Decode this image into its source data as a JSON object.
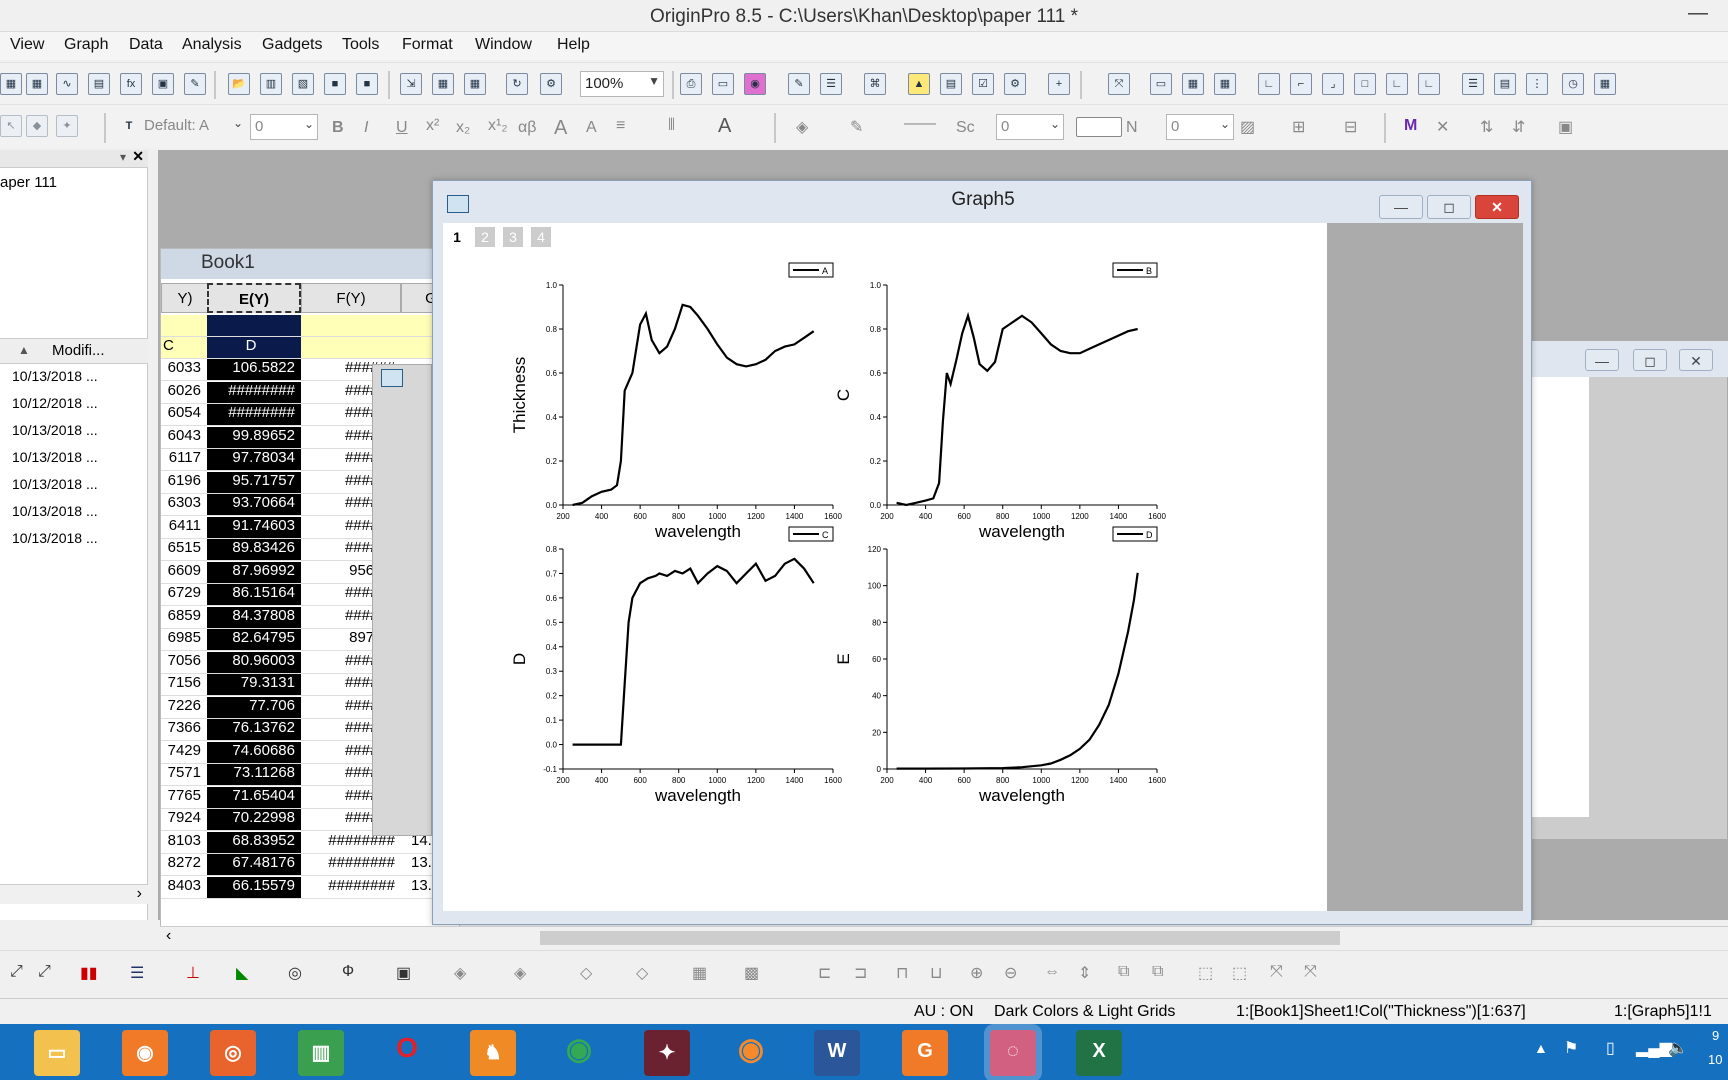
{
  "app": {
    "title": "OriginPro 8.5 - C:\\Users\\Khan\\Desktop\\paper 111 *"
  },
  "menu": [
    "View",
    "Graph",
    "Data",
    "Analysis",
    "Gadgets",
    "Tools",
    "Format",
    "Window",
    "Help"
  ],
  "toolbar": {
    "zoom": "100%",
    "font_name": "Default: A",
    "font_size": "0",
    "line_style": "Sc",
    "line_width": "0",
    "fill_label": "N",
    "fill_width": "0"
  },
  "project": {
    "folder": "aper 111",
    "column_header": "Modifi...",
    "dates": [
      "10/13/2018 ...",
      "10/12/2018 ...",
      "10/13/2018 ...",
      "10/13/2018 ...",
      "10/13/2018 ...",
      "10/13/2018 ...",
      "10/13/2018 ..."
    ]
  },
  "book1": {
    "title": "Book1",
    "col_left_header": "Y)",
    "col_e_header": "E(Y)",
    "col_f_header": "F(Y)",
    "col_g_header": "G",
    "row_c": "C",
    "row_d": "D",
    "left_col": [
      "6033",
      "6026",
      "6054",
      "6043",
      "6117",
      "6196",
      "6303",
      "6411",
      "6515",
      "6609",
      "6729",
      "6859",
      "6985",
      "7056",
      "7156",
      "7226",
      "7366",
      "7429",
      "7571",
      "7765",
      "7924",
      "8103",
      "8272",
      "8403"
    ],
    "e_col": [
      "106.5822",
      "########",
      "########",
      "99.89652",
      "97.78034",
      "95.71757",
      "93.70664",
      "91.74603",
      "89.83426",
      "87.96992",
      "86.15164",
      "84.37808",
      "82.64795",
      "80.96003",
      "79.3131",
      "77.706",
      "76.13762",
      "74.60686",
      "73.11268",
      "71.65404",
      "70.22998",
      "68.83952",
      "67.48176",
      "66.15579"
    ],
    "f_col": [
      "######",
      "######",
      "######",
      "######",
      "######",
      "######",
      "######",
      "######",
      "######",
      "956.22",
      "######",
      "######",
      "897.93",
      "######",
      "######",
      "######",
      "######",
      "######",
      "######",
      "######",
      "######",
      "########",
      "########",
      "########"
    ],
    "g_col": [
      "",
      "",
      "",
      "",
      "",
      "",
      "",
      "",
      "",
      "",
      "",
      "",
      "",
      "",
      "",
      "",
      "",
      "",
      "",
      "",
      "",
      "14.",
      "13.",
      "13."
    ]
  },
  "graph": {
    "title": "Graph5",
    "layers": [
      "1",
      "2",
      "3",
      "4"
    ],
    "xlabel": "wavelength"
  },
  "chart_data": [
    {
      "type": "line",
      "legend": "A",
      "ylabel": "Thickness",
      "xlabel": "wavelength",
      "xlim": [
        200,
        1600
      ],
      "ylim": [
        0.0,
        1.0
      ],
      "xticks": [
        "200",
        "400",
        "600",
        "800",
        "1000",
        "1200",
        "1400",
        "1600"
      ],
      "yticks": [
        "0.0",
        "0.2",
        "0.4",
        "0.6",
        "0.8",
        "1.0"
      ],
      "x": [
        250,
        300,
        350,
        400,
        450,
        480,
        500,
        520,
        560,
        600,
        630,
        660,
        700,
        740,
        780,
        820,
        860,
        900,
        950,
        1000,
        1050,
        1100,
        1150,
        1200,
        1250,
        1300,
        1350,
        1400,
        1450,
        1500
      ],
      "y": [
        0.0,
        0.01,
        0.04,
        0.06,
        0.07,
        0.09,
        0.2,
        0.52,
        0.6,
        0.82,
        0.87,
        0.75,
        0.69,
        0.72,
        0.8,
        0.91,
        0.9,
        0.86,
        0.8,
        0.73,
        0.67,
        0.64,
        0.63,
        0.64,
        0.66,
        0.7,
        0.72,
        0.73,
        0.76,
        0.79
      ]
    },
    {
      "type": "line",
      "legend": "B",
      "ylabel": "C",
      "xlabel": "wavelength",
      "xlim": [
        200,
        1600
      ],
      "ylim": [
        0.0,
        1.0
      ],
      "xticks": [
        "200",
        "400",
        "600",
        "800",
        "1000",
        "1200",
        "1400",
        "1600"
      ],
      "yticks": [
        "0.0",
        "0.2",
        "0.4",
        "0.6",
        "0.8",
        "1.0"
      ],
      "x": [
        250,
        300,
        350,
        400,
        440,
        470,
        490,
        510,
        530,
        560,
        590,
        620,
        650,
        680,
        720,
        760,
        800,
        850,
        900,
        950,
        1000,
        1050,
        1100,
        1150,
        1200,
        1250,
        1300,
        1350,
        1400,
        1450,
        1500
      ],
      "y": [
        0.01,
        0.0,
        0.01,
        0.02,
        0.03,
        0.1,
        0.38,
        0.6,
        0.55,
        0.66,
        0.78,
        0.86,
        0.76,
        0.64,
        0.61,
        0.65,
        0.8,
        0.83,
        0.86,
        0.83,
        0.78,
        0.73,
        0.7,
        0.69,
        0.69,
        0.71,
        0.73,
        0.75,
        0.77,
        0.79,
        0.8
      ]
    },
    {
      "type": "line",
      "legend": "C",
      "ylabel": "D",
      "xlabel": "wavelength",
      "xlim": [
        200,
        1600
      ],
      "ylim": [
        -0.1,
        0.8
      ],
      "xticks": [
        "200",
        "400",
        "600",
        "800",
        "1000",
        "1200",
        "1400",
        "1600"
      ],
      "yticks": [
        "-0.1",
        "0.0",
        "0.1",
        "0.2",
        "0.3",
        "0.4",
        "0.5",
        "0.6",
        "0.7",
        "0.8"
      ],
      "x": [
        250,
        300,
        350,
        400,
        450,
        500,
        520,
        540,
        560,
        600,
        640,
        680,
        700,
        740,
        780,
        820,
        860,
        900,
        950,
        1000,
        1050,
        1100,
        1150,
        1200,
        1250,
        1300,
        1350,
        1400,
        1450,
        1500
      ],
      "y": [
        0.0,
        0.0,
        0.0,
        0.0,
        0.0,
        0.0,
        0.25,
        0.5,
        0.6,
        0.66,
        0.68,
        0.69,
        0.7,
        0.69,
        0.71,
        0.7,
        0.72,
        0.66,
        0.7,
        0.73,
        0.71,
        0.66,
        0.7,
        0.74,
        0.67,
        0.69,
        0.74,
        0.76,
        0.72,
        0.66
      ]
    },
    {
      "type": "line",
      "legend": "D",
      "ylabel": "E",
      "xlabel": "wavelength",
      "xlim": [
        200,
        1600
      ],
      "ylim": [
        0,
        120
      ],
      "xticks": [
        "200",
        "400",
        "600",
        "800",
        "1000",
        "1200",
        "1400",
        "1600"
      ],
      "yticks": [
        "0",
        "20",
        "40",
        "60",
        "80",
        "100",
        "120"
      ],
      "x": [
        250,
        400,
        600,
        800,
        900,
        1000,
        1050,
        1100,
        1150,
        1200,
        1250,
        1300,
        1350,
        1400,
        1450,
        1480,
        1500
      ],
      "y": [
        0.2,
        0.2,
        0.3,
        0.5,
        1,
        2,
        3,
        5,
        7.5,
        11,
        16,
        24,
        35,
        52,
        75,
        92,
        107
      ]
    }
  ],
  "status": {
    "au": "AU : ON",
    "theme": "Dark Colors & Light Grids",
    "cell_ref": "1:[Book1]Sheet1!Col(\"Thickness\")[1:637]",
    "layer_ref": "1:[Graph5]1!1",
    "clock_top": "9",
    "clock_bottom": "10"
  }
}
